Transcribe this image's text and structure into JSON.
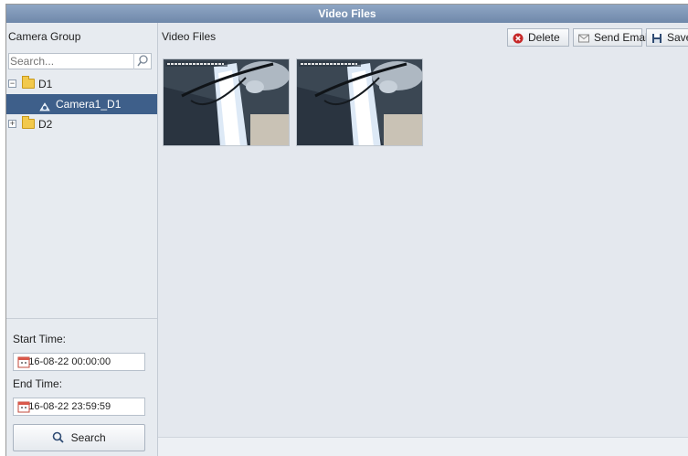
{
  "window": {
    "title": "Video Files"
  },
  "sidebar": {
    "header": "Camera Group",
    "search_placeholder": "Search...",
    "tree": [
      {
        "label": "D1",
        "expander": "−"
      },
      {
        "label": "Camera1_D1"
      },
      {
        "label": "D2",
        "expander": "+"
      }
    ],
    "start_time_label": "Start Time:",
    "start_time_value": "2016-08-22 00:00:00",
    "end_time_label": "End Time:",
    "end_time_value": "2016-08-22 23:59:59",
    "search_button": "Search"
  },
  "main": {
    "title": "Video Files",
    "toolbar": {
      "delete_label": "Delete",
      "send_email_label": "Send Email",
      "save_label": "Save a"
    },
    "thumbnails": [
      {
        "name": "video-thumbnail-1"
      },
      {
        "name": "video-thumbnail-2"
      }
    ]
  },
  "colors": {
    "title_bar": "#7f97b8",
    "selection": "#3e5f8a",
    "panel_bg": "#e4e8ee",
    "delete_icon": "#c62828"
  }
}
